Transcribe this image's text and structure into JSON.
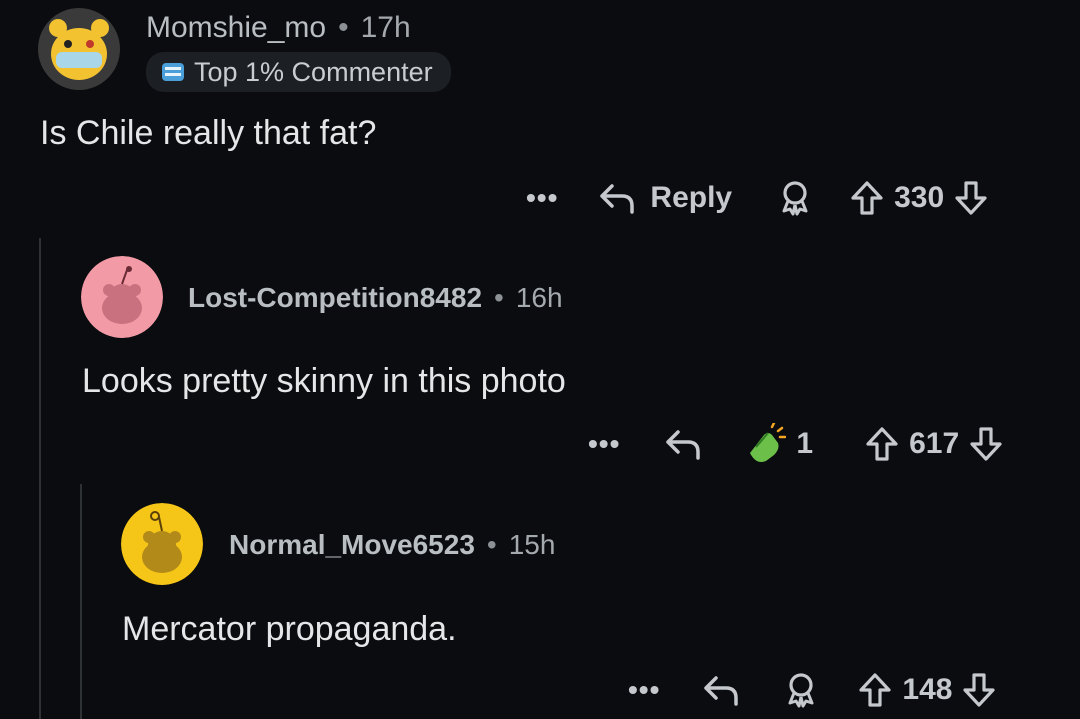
{
  "comments": [
    {
      "username": "Momshie_mo",
      "time": "17h",
      "badge": "Top 1% Commenter",
      "body": "Is Chile really that fat?",
      "actions": {
        "more": "•••",
        "reply": "Reply",
        "score": "330"
      },
      "avatar_color": "#f2c230"
    },
    {
      "username": "Lost-Competition8482",
      "time": "16h",
      "body": "Looks pretty skinny in this photo",
      "actions": {
        "more": "•••",
        "award_count": "1",
        "score": "617"
      },
      "avatar_color": "#f29aa6"
    },
    {
      "username": "Normal_Move6523",
      "time": "15h",
      "body": "Mercator propaganda.",
      "actions": {
        "more": "•••",
        "score": "148"
      },
      "avatar_color": "#f5c518"
    }
  ],
  "separator": "•",
  "icons": [
    "reply-arrow-icon",
    "award-icon",
    "upvote-icon",
    "downvote-icon",
    "more-dots-icon",
    "top-commenter-badge-icon",
    "clapping-hands-award-icon"
  ]
}
